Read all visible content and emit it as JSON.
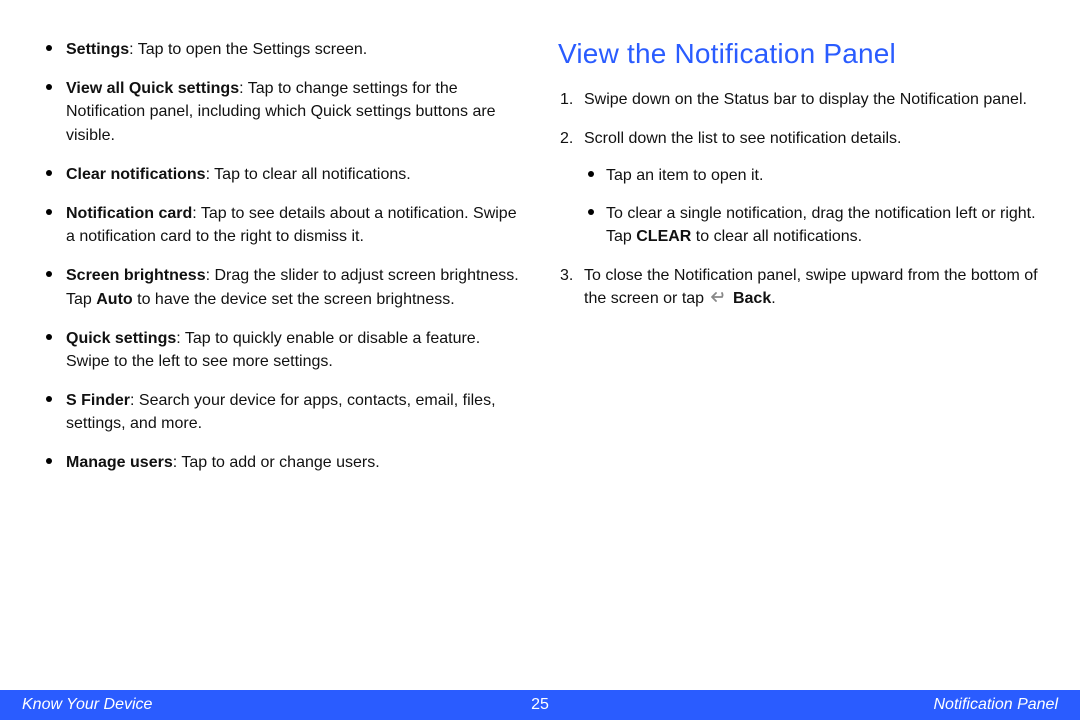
{
  "left_column": {
    "items": [
      {
        "term": "Settings",
        "desc": ": Tap to open the Settings screen."
      },
      {
        "term": "View all Quick settings",
        "desc": ": Tap to change settings for the Notification panel, including which Quick settings buttons are visible."
      },
      {
        "term": "Clear notifications",
        "desc": ": Tap to clear all notifications."
      },
      {
        "term": "Notification card",
        "desc": ": Tap to see details about a notification. Swipe a notification card to the right to dismiss it."
      },
      {
        "term": "Screen brightness",
        "desc_before": ": Drag the slider to adjust screen brightness. Tap ",
        "bold_inline": "Auto",
        "desc_after": " to have the device set the screen brightness."
      },
      {
        "term": "Quick settings",
        "desc": ": Tap to quickly enable or disable a feature. Swipe to the left to see more settings."
      },
      {
        "term": "S Finder",
        "desc": ": Search your device for apps, contacts, email, files, settings, and more."
      },
      {
        "term": "Manage users",
        "desc": ": Tap to add or change users."
      }
    ]
  },
  "right_column": {
    "title": "View the Notification Panel",
    "steps": {
      "s1": "Swipe down on the Status bar to display the Notification panel.",
      "s2": "Scroll down the list to see notification details.",
      "s2_sub1": "Tap an item to open it.",
      "s2_sub2_before": "To clear a single notification, drag the notification left or right. Tap ",
      "s2_sub2_bold": "CLEAR",
      "s2_sub2_after": " to clear all notifications.",
      "s3_before": "To close the Notification panel, swipe upward from the bottom of the screen or tap ",
      "s3_bold": "Back",
      "s3_after": "."
    }
  },
  "footer": {
    "left": "Know Your Device",
    "center": "25",
    "right": "Notification Panel"
  }
}
